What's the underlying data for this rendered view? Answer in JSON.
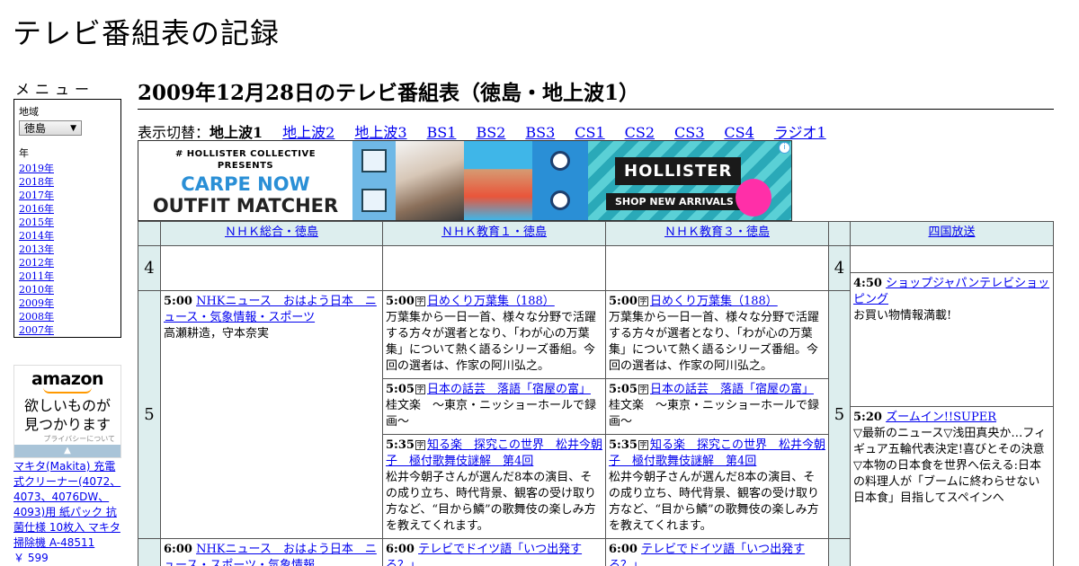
{
  "site": {
    "title": "テレビ番組表の記録"
  },
  "sidebar": {
    "menu_label": "メニュー",
    "region_label": "地域",
    "region_value": "徳島",
    "year_label": "年",
    "years": [
      "2019年",
      "2018年",
      "2017年",
      "2016年",
      "2015年",
      "2014年",
      "2013年",
      "2012年",
      "2011年",
      "2010年",
      "2009年",
      "2008年",
      "2007年"
    ]
  },
  "side_ad": {
    "logo": "amazon",
    "tagline_1": "欲しいものが",
    "tagline_2": "見つかります",
    "privacy": "プライバシーについて"
  },
  "product": {
    "name": "マキタ(Makita) 充電式クリーナー(4072、4073、4076DW、4093)用 紙パック 抗菌仕様 10枚入 マキタ 掃除機 A-48511",
    "price": "￥ 599"
  },
  "page": {
    "heading": "2009年12月28日のテレビ番組表（徳島・地上波1）",
    "switch_label": "表示切替：",
    "current_band": "地上波1",
    "bands": [
      "地上波2",
      "地上波3",
      "BS1",
      "BS2",
      "BS3",
      "CS1",
      "CS2",
      "CS3",
      "CS4",
      "ラジオ1"
    ]
  },
  "banner": {
    "small": "# HOLLISTER COLLECTIVE",
    "presents": "PRESENTS",
    "headline_1": "CARPE NOW",
    "headline_2": "OUTFIT MATCHER",
    "brand": "HOLLISTER",
    "cta": "SHOP NEW ARRIVALS",
    "info": "i"
  },
  "channels": [
    "ＮＨＫ総合・徳島",
    "ＮＨＫ教育１・徳島",
    "ＮＨＫ教育３・徳島",
    "四国放送"
  ],
  "hours": [
    "4",
    "5"
  ],
  "programs": {
    "nhk_sogo": [
      {
        "time": "5:00",
        "title": "NHKニュース　おはよう日本　ニュース・気象情報・スポーツ",
        "desc": "高瀬耕造，守本奈実"
      },
      {
        "time": "6:00",
        "title": "NHKニュース　おはよう日本　ニュース・スポーツ・気象情報",
        "desc": ""
      }
    ],
    "nhk_edu1": [
      {
        "time": "5:00",
        "title": "日めくり万葉集（188）",
        "desc": "万葉集から一日一首、様々な分野で活躍する方々が選者となり、「わが心の万葉集」について熱く語るシリーズ番組。今回の選者は、作家の阿川弘之。"
      },
      {
        "time": "5:05",
        "title": "日本の話芸　落語「宿屋の富」",
        "desc": "桂文楽　～東京・ニッショーホールで録画～"
      },
      {
        "time": "5:35",
        "title": "知る楽　探究この世界　松井今朝子　極付歌舞伎謎解　第4回",
        "desc": "松井今朝子さんが選んだ8本の演目、その成り立ち、時代背景、観客の受け取り方など、“目から鱗”の歌舞伎の楽しみ方を教えてくれます。"
      },
      {
        "time": "6:00",
        "title": "テレビでドイツ語「いつ出発する？」",
        "desc": ""
      }
    ],
    "nhk_edu3": [
      {
        "time": "5:00",
        "title": "日めくり万葉集（188）",
        "desc": "万葉集から一日一首、様々な分野で活躍する方々が選者となり、「わが心の万葉集」について熱く語るシリーズ番組。今回の選者は、作家の阿川弘之。"
      },
      {
        "time": "5:05",
        "title": "日本の話芸　落語「宿屋の富」",
        "desc": "桂文楽　～東京・ニッショーホールで録画～"
      },
      {
        "time": "5:35",
        "title": "知る楽　探究この世界　松井今朝子　極付歌舞伎謎解　第4回",
        "desc": "松井今朝子さんが選んだ8本の演目、その成り立ち、時代背景、観客の受け取り方など、“目から鱗”の歌舞伎の楽しみ方を教えてくれます。"
      },
      {
        "time": "6:00",
        "title": "テレビでドイツ語「いつ出発する？」",
        "desc": ""
      }
    ],
    "shikoku": [
      {
        "time": "4:50",
        "title": "ショップジャパンテレビショッピング",
        "desc": "お買い物情報満載!"
      },
      {
        "time": "5:20",
        "title": "ズームイン!!SUPER",
        "desc": "▽最新のニュース▽浅田真央か…フィギュア五輪代表決定!喜びとその決意▽本物の日本食を世界へ伝える:日本の料理人が「ブームに終わらせない日本食」目指してスペインへ"
      }
    ]
  },
  "icon_mark": "字"
}
